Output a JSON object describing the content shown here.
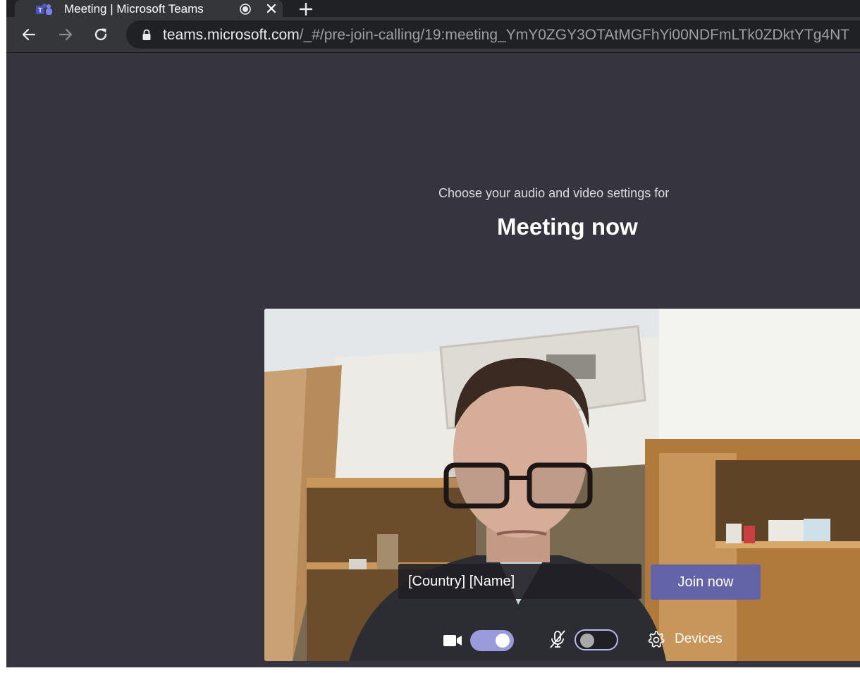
{
  "browser": {
    "tab": {
      "title": "Meeting | Microsoft Teams",
      "favicon": "teams-icon"
    },
    "new_tab_icon": "plus-icon",
    "nav": {
      "back_icon": "arrow-left-icon",
      "forward_icon": "arrow-right-icon",
      "reload_icon": "reload-icon"
    },
    "address": {
      "host": "teams.microsoft.com",
      "path": "/_#/pre-join-calling/19:meeting_YmY0ZGY3OTAtMGFhYi00NDFmLTk0ZDktYTg4NT",
      "secure_icon": "lock-icon"
    }
  },
  "prejoin": {
    "prompt": "Choose your audio and video settings for",
    "meeting_title": "Meeting now",
    "name_field": {
      "value": "[Country] [Name]"
    },
    "join_button": "Join now",
    "controls": {
      "camera": {
        "icon": "video-camera-icon",
        "state": "on"
      },
      "microphone": {
        "icon": "microphone-off-icon",
        "state": "off"
      },
      "devices": {
        "icon": "gear-icon",
        "label": "Devices"
      }
    }
  },
  "colors": {
    "page_bg": "#36353f",
    "accent": "#6264a7",
    "toggle_on": "#9a9bdc",
    "toggle_off_border": "#b8b9ee"
  }
}
